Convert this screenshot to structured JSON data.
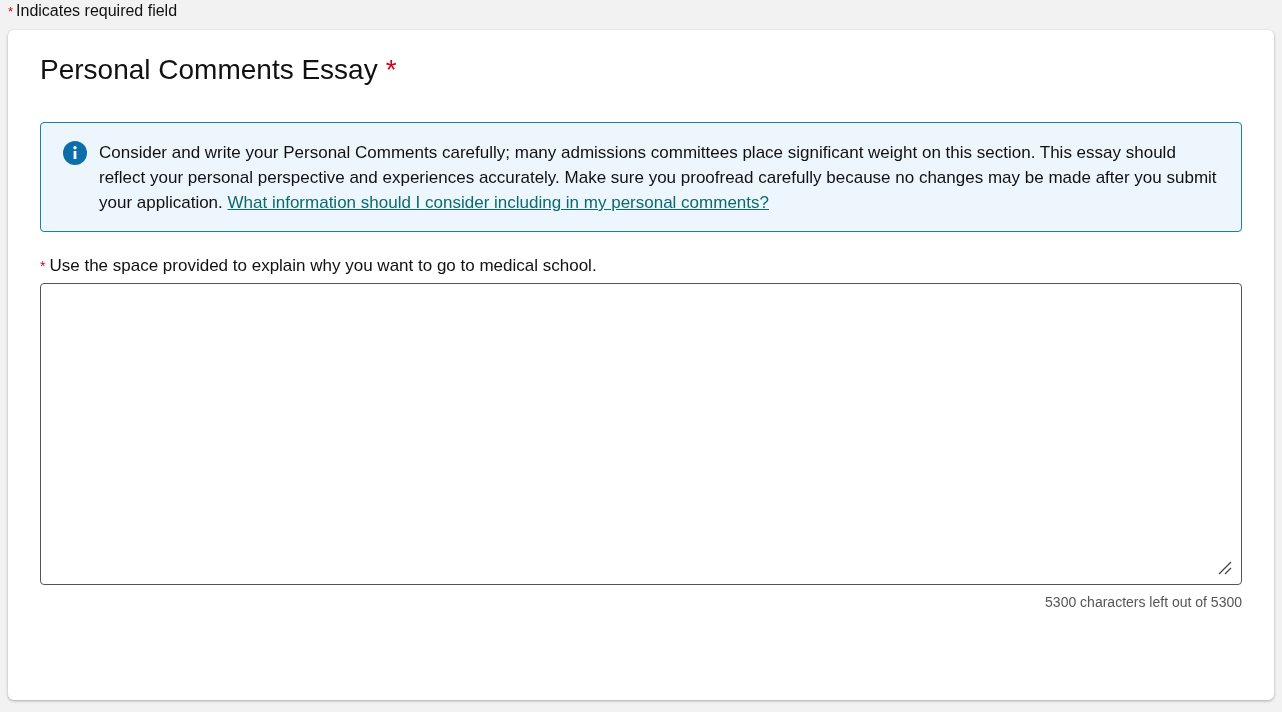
{
  "required_note": {
    "marker": "*",
    "text": "Indicates required field"
  },
  "section": {
    "title": "Personal Comments Essay",
    "required_marker": "*"
  },
  "info": {
    "text": "Consider and write your Personal Comments carefully; many admissions committees place significant weight on this section. This essay should reflect your personal perspective and experiences accurately. Make sure you proofread carefully because no changes may be made after you submit your application.",
    "link": "What information should I consider including in my personal comments?"
  },
  "field": {
    "required_marker": "*",
    "label": "Use the space provided to explain why you want to go to medical school."
  },
  "counter": "5300 characters left out of 5300"
}
